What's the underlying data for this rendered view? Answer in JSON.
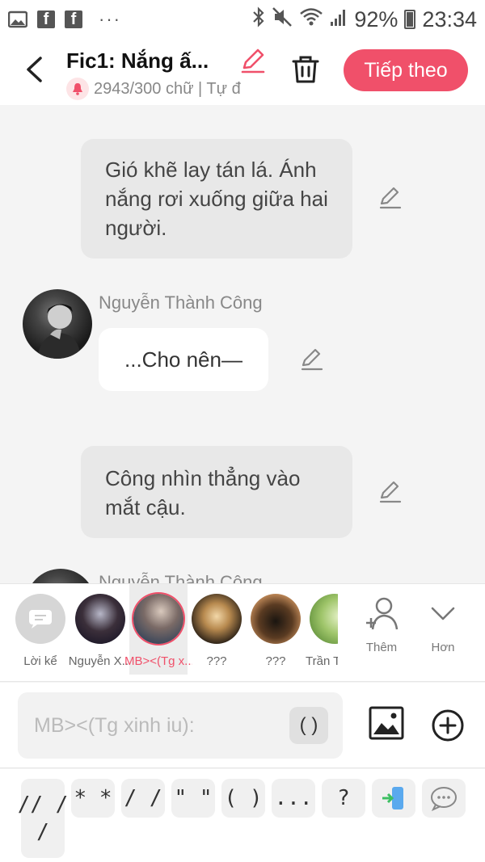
{
  "status_bar": {
    "fb1": "f",
    "fb2": "f",
    "more": "···",
    "battery": "92%",
    "time": "23:34"
  },
  "header": {
    "title": "Fic1: Nắng ấ...",
    "subtitle": "2943/300 chữ | Tự đ",
    "next_label": "Tiếp theo"
  },
  "chat": {
    "messages": [
      {
        "type": "narration",
        "text": "Gió khẽ lay tán lá. Ánh nắng rơi xuống giữa hai người."
      },
      {
        "type": "character",
        "speaker": "Nguyễn Thành Công",
        "text": "...Cho nên—"
      },
      {
        "type": "narration",
        "text": "Công nhìn thẳng vào mắt cậu."
      },
      {
        "type": "character",
        "speaker": "Nguyễn Thành Công",
        "text": ""
      }
    ]
  },
  "characters": [
    {
      "label": "Lời kể"
    },
    {
      "label": "Nguyễn X..."
    },
    {
      "label": "MB><(Tg x..."
    },
    {
      "label": "???"
    },
    {
      "label": "???"
    },
    {
      "label": "Trần T"
    }
  ],
  "tools": {
    "add_label": "Thêm",
    "more_label": "Hơn"
  },
  "input": {
    "placeholder": "MB><(Tg xinh iu):",
    "paren": "( )"
  },
  "quick_symbols": [
    "// /\n/",
    "* *",
    "/ /",
    "\" \"",
    "( )",
    "...",
    "?"
  ],
  "colors": {
    "accent": "#f0506a",
    "narration_bg": "#e8e8e8",
    "chat_bg": "#f4f4f4"
  }
}
